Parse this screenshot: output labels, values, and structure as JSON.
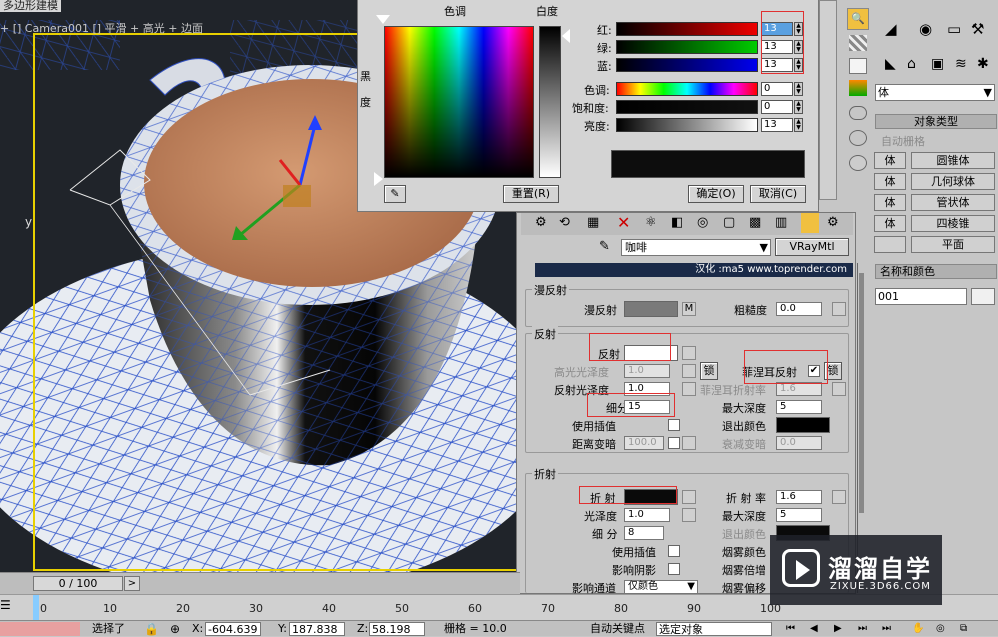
{
  "viewport": {
    "title": "多边形建模",
    "label": "+ [] Camera001 [] 平滑 + 高光 + 边面"
  },
  "color_picker": {
    "hue_label": "色调",
    "whiteness_label": "白度",
    "black_label_1": "黑",
    "black_label_2": "度",
    "red_label": "红:",
    "green_label": "绿:",
    "blue_label": "蓝:",
    "hue_row_label": "色调:",
    "sat_label": "饱和度:",
    "val_label": "亮度:",
    "red_value": "13",
    "green_value": "13",
    "blue_value": "13",
    "hue_value": "0",
    "sat_value": "0",
    "val_value": "13",
    "reset_button": "重置(R)",
    "ok_button": "确定(O)",
    "cancel_button": "取消(C)",
    "preview_color": "#0d0d0d"
  },
  "command_panel": {
    "dropdown_value": "体",
    "object_type_title": "对象类型",
    "autogrid": "自动栅格",
    "buttons": [
      "体",
      "圆锥体",
      "体",
      "几何球体",
      "体",
      "管状体",
      "体",
      "四棱锥",
      "",
      "平面"
    ],
    "name_color_title": "名称和颜色",
    "name_value": "001"
  },
  "material_editor": {
    "material_name": "咖啡",
    "material_type": "VRayMtl",
    "banner_text": "汉化 :ma5  www.toprender.com",
    "diffuse_group": "漫反射",
    "diffuse_label": "漫反射",
    "diffuse_map_btn": "M",
    "roughness_label": "粗糙度",
    "roughness_value": "0.0",
    "reflect_group": "反射",
    "reflect_label": "反射",
    "hilight_gloss_label": "高光光泽度",
    "hilight_gloss_value": "1.0",
    "lock_label": "锁",
    "fresnel_label": "菲涅耳反射",
    "fresnel_lock": "锁",
    "refl_gloss_label": "反射光泽度",
    "refl_gloss_value": "1.0",
    "fresnel_ior_label": "菲涅耳折射率",
    "fresnel_ior_value": "1.6",
    "subdivs_label": "细分",
    "subdivs_value": "15",
    "max_depth_label": "最大深度",
    "max_depth_value": "5",
    "use_interp_label": "使用插值",
    "exit_color_label": "退出颜色",
    "dim_distance_label": "距离变暗",
    "dim_distance_value": "100.0",
    "dim_falloff_label": "衰减变暗",
    "dim_falloff_value": "0.0",
    "refract_group": "折射",
    "refract_label": "折 射",
    "ior_label": "折 射 率",
    "ior_value": "1.6",
    "gloss_label": "光泽度",
    "gloss_value": "1.0",
    "refr_max_depth_label": "最大深度",
    "refr_max_depth_value": "5",
    "refr_subdivs_label": "细 分",
    "refr_subdivs_value": "8",
    "refr_exit_color_label": "退出颜色",
    "refr_use_interp_label": "使用插值",
    "fog_color_label": "烟雾颜色",
    "affect_shadows_label": "影响阴影",
    "fog_mult_label": "烟雾倍增",
    "affect_channels_label": "影响通道",
    "affect_channels_value": "仅颜色",
    "fog_bias_label": "烟雾偏移"
  },
  "timeline": {
    "frame": "0 / 100",
    "ticks": [
      "0",
      "10",
      "20",
      "30",
      "40",
      "50",
      "60",
      "70",
      "80",
      "90",
      "100"
    ]
  },
  "status_bar": {
    "select_label": "选择了",
    "x_label": "X:",
    "x_value": "-604.639",
    "y_label": "Y:",
    "y_value": "187.838",
    "z_label": "Z:",
    "z_value": "58.198",
    "grid_label": "栅格 = 10.0",
    "auto_key": "自动关键点",
    "selected_objects": "选定对象"
  },
  "watermark": {
    "brand": "溜溜自学",
    "url": "ZIXUE.3D66.COM"
  }
}
